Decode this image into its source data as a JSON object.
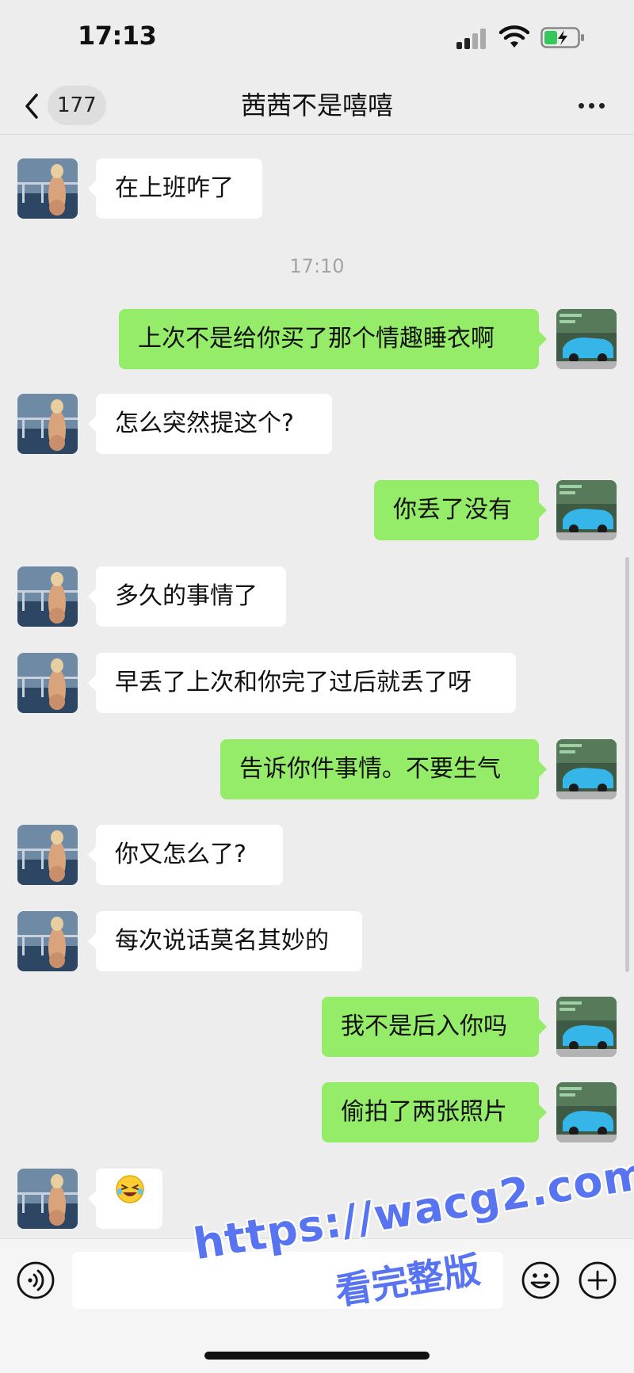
{
  "status_bar": {
    "time": "17:13"
  },
  "header": {
    "unread_count": "177",
    "title": "茜茜不是嘻嘻"
  },
  "timestamp": "17:10",
  "messages": [
    {
      "side": "in",
      "text": "在上班咋了"
    },
    {
      "side": "out",
      "text": "上次不是给你买了那个情趣睡衣啊"
    },
    {
      "side": "in",
      "text": "怎么突然提这个?"
    },
    {
      "side": "out",
      "text": "你丢了没有"
    },
    {
      "side": "in",
      "text": "多久的事情了"
    },
    {
      "side": "in",
      "text": "早丢了上次和你完了过后就丢了呀"
    },
    {
      "side": "out",
      "text": "告诉你件事情。不要生气"
    },
    {
      "side": "in",
      "text": "你又怎么了?"
    },
    {
      "side": "in",
      "text": "每次说话莫名其妙的"
    },
    {
      "side": "out",
      "text": "我不是后入你吗"
    },
    {
      "side": "out",
      "text": "偷拍了两张照片"
    },
    {
      "side": "in",
      "text": "",
      "emoji": "grinning-squint-sweat-emoji"
    }
  ],
  "input_bar": {
    "placeholder": ""
  },
  "watermark": {
    "url": "https://wacg2.com",
    "caption": "看完整版"
  },
  "colors": {
    "outgoing_bubble": "#95ec69",
    "incoming_bubble": "#ffffff",
    "background": "#ededed",
    "watermark": "#5874f0"
  }
}
